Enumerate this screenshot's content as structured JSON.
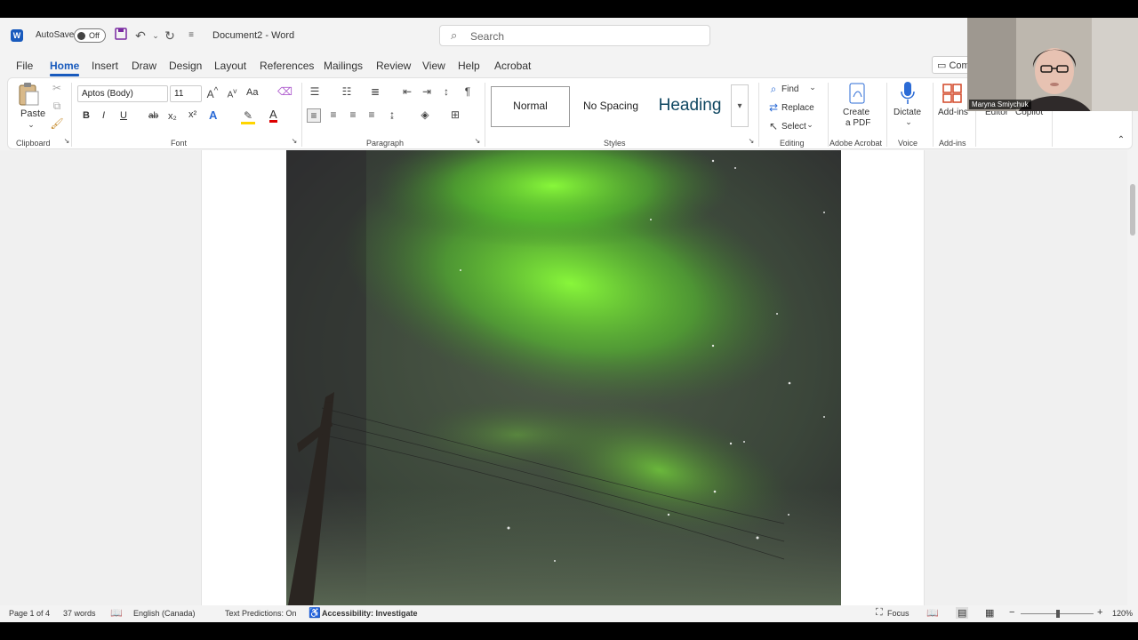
{
  "title_bar": {
    "autosave_label": "AutoSave",
    "autosave_state": "Off",
    "document_name": "Document2",
    "app_name": "Word",
    "separator": "-"
  },
  "search": {
    "placeholder": "Search"
  },
  "menu_tabs": [
    "File",
    "Home",
    "Insert",
    "Draw",
    "Design",
    "Layout",
    "References",
    "Mailings",
    "Review",
    "View",
    "Help",
    "Acrobat"
  ],
  "active_tab": "Home",
  "comments_button": "Com",
  "ribbon": {
    "clipboard": {
      "paste": "Paste",
      "label": "Clipboard"
    },
    "font": {
      "name": "Aptos (Body)",
      "size": "11",
      "label": "Font",
      "change_case": "Aa",
      "bold": "B",
      "italic": "I",
      "underline": "U",
      "strike": "ab",
      "subscript": "x₂",
      "superscript": "x²",
      "text_effects": "A",
      "font_color": "A"
    },
    "paragraph": {
      "label": "Paragraph"
    },
    "styles": {
      "items": [
        "Normal",
        "No Spacing",
        "Heading"
      ],
      "label": "Styles"
    },
    "editing": {
      "find": "Find",
      "replace": "Replace",
      "select": "Select",
      "label": "Editing"
    },
    "acrobat": {
      "create_pdf_line1": "Create",
      "create_pdf_line2": "a PDF",
      "label": "Adobe Acrobat"
    },
    "voice": {
      "dictate": "Dictate",
      "label": "Voice"
    },
    "addins": {
      "button": "Add-ins",
      "label": "Add-ins"
    },
    "editor": "Editor",
    "copilot": "Copilot"
  },
  "status_bar": {
    "page": "Page 1 of 4",
    "words": "37 words",
    "language": "English (Canada)",
    "predictions": "Text Predictions: On",
    "accessibility": "Accessibility: Investigate",
    "focus": "Focus",
    "zoom": "120%"
  },
  "webcam": {
    "participant": "Maryna Smiychuk"
  },
  "colors": {
    "accent": "#185abd",
    "aurora": "#7cff3a"
  },
  "icons": [
    "word-logo-icon",
    "save-icon",
    "undo-icon",
    "redo-icon",
    "search-icon",
    "paste-icon",
    "cut-icon",
    "copy-icon",
    "format-painter-icon",
    "find-icon",
    "replace-icon",
    "select-icon",
    "pdf-icon",
    "microphone-icon",
    "addins-icon",
    "comment-icon",
    "proofing-icon",
    "accessibility-icon",
    "focus-icon",
    "read-mode-icon",
    "print-layout-icon",
    "web-layout-icon"
  ]
}
